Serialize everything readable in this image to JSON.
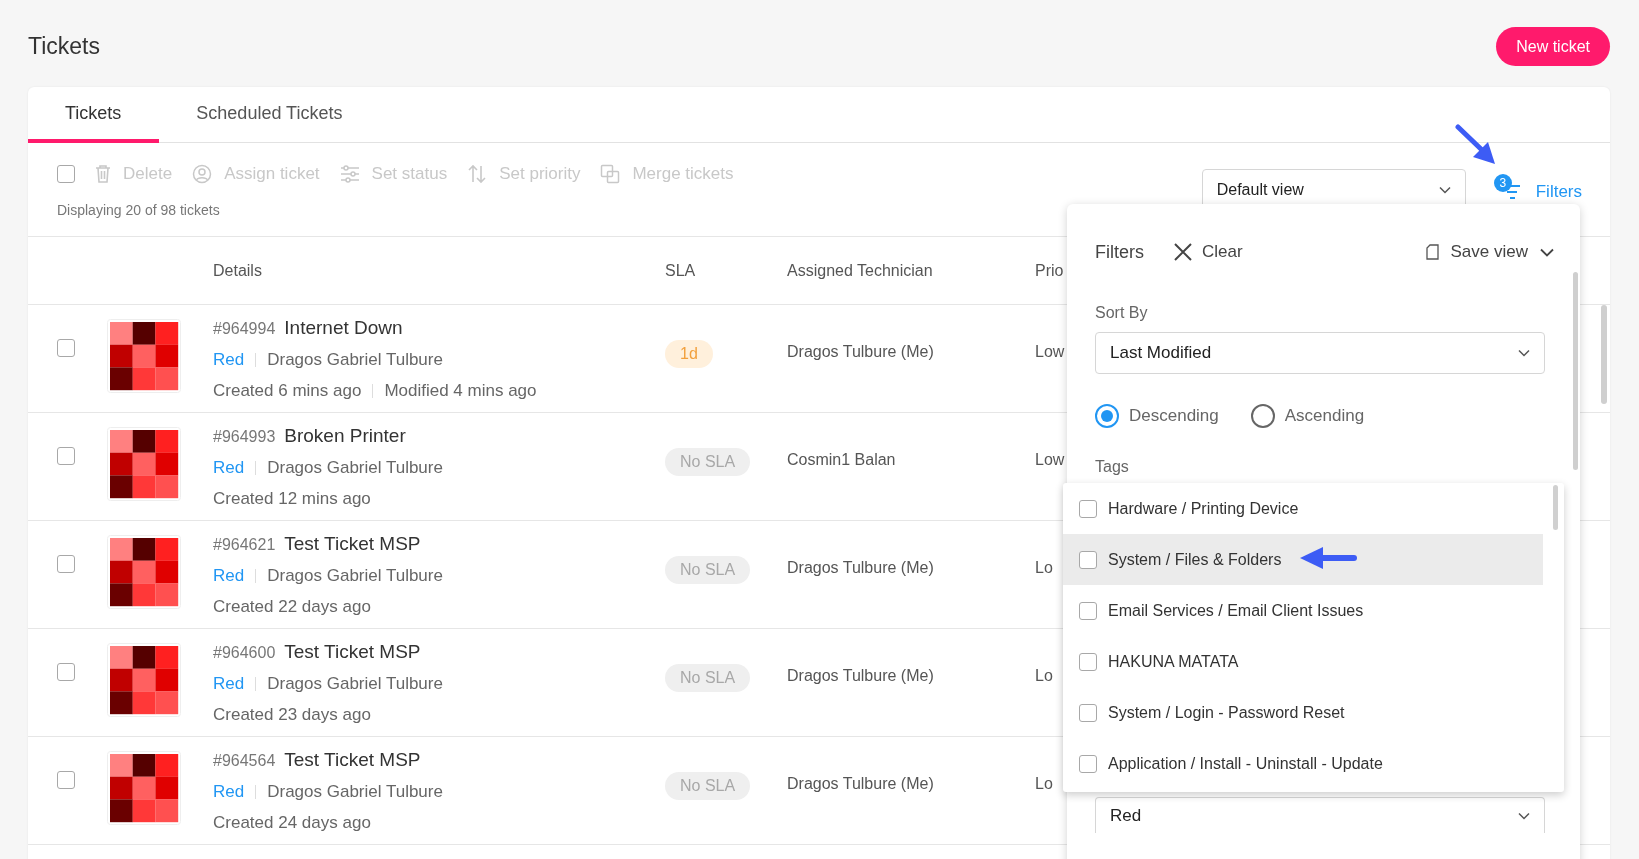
{
  "page": {
    "title": "Tickets",
    "new_button": "New ticket"
  },
  "tabs": [
    {
      "label": "Tickets",
      "selected": true
    },
    {
      "label": "Scheduled Tickets",
      "selected": false
    }
  ],
  "toolbar": {
    "select_all": {
      "checked": false
    },
    "actions": [
      {
        "kind": "delete",
        "label": "Delete",
        "disabled": true
      },
      {
        "kind": "assign",
        "label": "Assign ticket",
        "disabled": true
      },
      {
        "kind": "status",
        "label": "Set status",
        "disabled": true
      },
      {
        "kind": "priority",
        "label": "Set priority",
        "disabled": true
      },
      {
        "kind": "merge",
        "label": "Merge tickets",
        "disabled": true
      }
    ],
    "count_text": "Displaying 20 of 98 tickets",
    "view_select": {
      "value": "Default view"
    },
    "filters_button": {
      "label": "Filters",
      "badge": "3"
    }
  },
  "table": {
    "columns": [
      "Details",
      "SLA",
      "Assigned Technician",
      "Prio"
    ],
    "rows": [
      {
        "checked": false,
        "number": "#964994",
        "title": "Internet Down",
        "tag": "Red",
        "requester": "Dragos Gabriel Tulbure",
        "created": "Created 6 mins ago",
        "modified": "Modified 4 mins ago",
        "sla": {
          "kind": "due",
          "label": "1d"
        },
        "technician": "Dragos Tulbure (Me)",
        "priority": "Low"
      },
      {
        "checked": false,
        "number": "#964993",
        "title": "Broken Printer",
        "tag": "Red",
        "requester": "Dragos Gabriel Tulbure",
        "created": "Created 12 mins ago",
        "sla": {
          "kind": "none",
          "label": "No SLA"
        },
        "technician": "Cosmin1 Balan",
        "priority": "Low"
      },
      {
        "checked": false,
        "number": "#964621",
        "title": "Test Ticket MSP",
        "tag": "Red",
        "requester": "Dragos Gabriel Tulbure",
        "created": "Created 22 days ago",
        "sla": {
          "kind": "none",
          "label": "No SLA"
        },
        "technician": "Dragos Tulbure (Me)",
        "priority": "Lo"
      },
      {
        "checked": false,
        "number": "#964600",
        "title": "Test Ticket MSP",
        "tag": "Red",
        "requester": "Dragos Gabriel Tulbure",
        "created": "Created 23 days ago",
        "sla": {
          "kind": "none",
          "label": "No SLA"
        },
        "technician": "Dragos Tulbure (Me)",
        "priority": "Lo"
      },
      {
        "checked": false,
        "number": "#964564",
        "title": "Test Ticket MSP",
        "tag": "Red",
        "requester": "Dragos Gabriel Tulbure",
        "created": "Created 24 days ago",
        "sla": {
          "kind": "none",
          "label": "No SLA"
        },
        "technician": "Dragos Tulbure (Me)",
        "priority": "Lo"
      }
    ]
  },
  "filter_panel": {
    "title": "Filters",
    "clear": "Clear",
    "save_view": "Save view",
    "sort_label": "Sort By",
    "sort_value": "Last Modified",
    "order": [
      {
        "label": "Descending",
        "selected": true
      },
      {
        "label": "Ascending",
        "selected": false
      }
    ],
    "tags_label": "Tags",
    "tag_options": [
      {
        "label": "Hardware / Printing Device",
        "checked": false,
        "highlighted": false
      },
      {
        "label": "System / Files & Folders",
        "checked": false,
        "highlighted": true
      },
      {
        "label": "Email Services / Email Client Issues",
        "checked": false,
        "highlighted": false
      },
      {
        "label": "HAKUNA MATATA",
        "checked": false,
        "highlighted": false
      },
      {
        "label": "System / Login - Password Reset",
        "checked": false,
        "highlighted": false
      },
      {
        "label": "Application / Install - Uninstall - Update",
        "checked": false,
        "highlighted": false
      }
    ],
    "next_select_value": "Red"
  }
}
